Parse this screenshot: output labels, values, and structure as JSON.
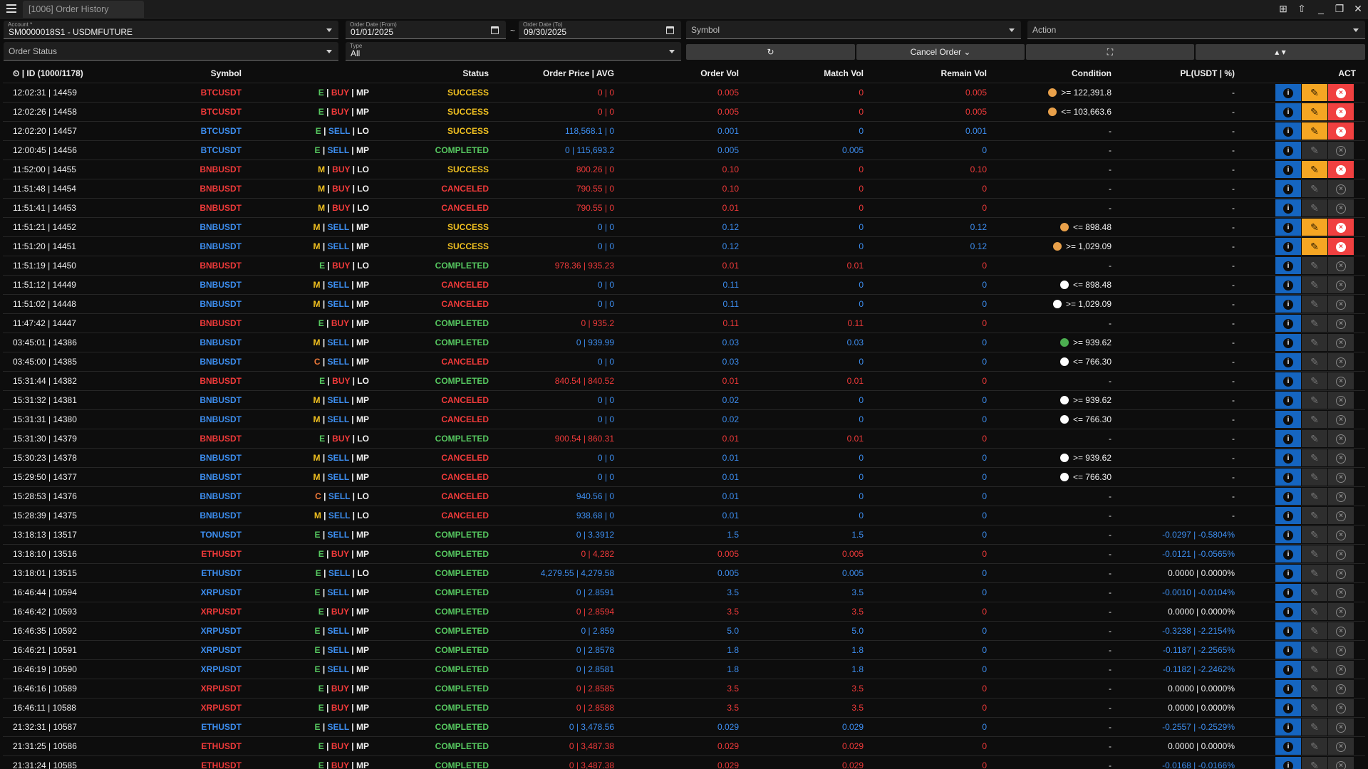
{
  "window": {
    "tab_title": "[1006] Order History"
  },
  "filters": {
    "account_label": "Account *",
    "account_value": "SM0000018S1 - USDMFUTURE",
    "date_from_label": "Order Date (From)",
    "date_from_value": "01/01/2025",
    "date_sep": "~",
    "date_to_label": "Order Date (To)",
    "date_to_value": "09/30/2025",
    "symbol_placeholder": "Symbol",
    "action_placeholder": "Action",
    "order_status_placeholder": "Order Status",
    "type_label": "Type",
    "type_value": "All",
    "refresh_label": "↻",
    "cancel_order_label": "Cancel Order ⌄",
    "fullscreen_label": "⛶",
    "sort_label": "▴ ▾"
  },
  "table": {
    "headers": {
      "id": "| ID (1000/1178)",
      "symbol": "Symbol",
      "status": "Status",
      "price": "Order Price | AVG",
      "order_vol": "Order Vol",
      "match_vol": "Match Vol",
      "remain_vol": "Remain Vol",
      "condition": "Condition",
      "pl": "PL(USDT | %)",
      "act": "ACT"
    },
    "rows": [
      {
        "id": "12:02:31 | 14459",
        "symbol": "BTCUSDT",
        "mode": "E",
        "side": "BUY",
        "otype": "MP",
        "status": "SUCCESS",
        "price": "0 | 0",
        "ovol": "0.005",
        "mvol": "0",
        "rvol": "0.005",
        "cond_dot": "#e8a04a",
        "cond": ">= 122,391.8",
        "pl": "-",
        "pl_color": "white",
        "editable": true
      },
      {
        "id": "12:02:26 | 14458",
        "symbol": "BTCUSDT",
        "mode": "E",
        "side": "BUY",
        "otype": "MP",
        "status": "SUCCESS",
        "price": "0 | 0",
        "ovol": "0.005",
        "mvol": "0",
        "rvol": "0.005",
        "cond_dot": "#e8a04a",
        "cond": "<= 103,663.6",
        "pl": "-",
        "pl_color": "white",
        "editable": true
      },
      {
        "id": "12:02:20 | 14457",
        "symbol": "BTCUSDT",
        "mode": "E",
        "side": "SELL",
        "otype": "LO",
        "status": "SUCCESS",
        "price": "118,568.1 | 0",
        "ovol": "0.001",
        "mvol": "0",
        "rvol": "0.001",
        "cond_dot": "",
        "cond": "-",
        "pl": "-",
        "pl_color": "white",
        "editable": true
      },
      {
        "id": "12:00:45 | 14456",
        "symbol": "BTCUSDT",
        "mode": "E",
        "side": "SELL",
        "otype": "MP",
        "status": "COMPLETED",
        "price": "0 | 115,693.2",
        "ovol": "0.005",
        "mvol": "0.005",
        "rvol": "0",
        "cond_dot": "",
        "cond": "-",
        "pl": "-",
        "pl_color": "white",
        "editable": false
      },
      {
        "id": "11:52:00 | 14455",
        "symbol": "BNBUSDT",
        "mode": "M",
        "side": "BUY",
        "otype": "LO",
        "status": "SUCCESS",
        "price": "800.26 | 0",
        "ovol": "0.10",
        "mvol": "0",
        "rvol": "0.10",
        "cond_dot": "",
        "cond": "-",
        "pl": "-",
        "pl_color": "white",
        "editable": true
      },
      {
        "id": "11:51:48 | 14454",
        "symbol": "BNBUSDT",
        "mode": "M",
        "side": "BUY",
        "otype": "LO",
        "status": "CANCELED",
        "price": "790.55 | 0",
        "ovol": "0.10",
        "mvol": "0",
        "rvol": "0",
        "cond_dot": "",
        "cond": "-",
        "pl": "-",
        "pl_color": "white",
        "editable": false
      },
      {
        "id": "11:51:41 | 14453",
        "symbol": "BNBUSDT",
        "mode": "M",
        "side": "BUY",
        "otype": "LO",
        "status": "CANCELED",
        "price": "790.55 | 0",
        "ovol": "0.01",
        "mvol": "0",
        "rvol": "0",
        "cond_dot": "",
        "cond": "-",
        "pl": "-",
        "pl_color": "white",
        "editable": false
      },
      {
        "id": "11:51:21 | 14452",
        "symbol": "BNBUSDT",
        "mode": "M",
        "side": "SELL",
        "otype": "MP",
        "status": "SUCCESS",
        "price": "0 | 0",
        "ovol": "0.12",
        "mvol": "0",
        "rvol": "0.12",
        "cond_dot": "#e8a04a",
        "cond": "<= 898.48",
        "pl": "-",
        "pl_color": "white",
        "editable": true
      },
      {
        "id": "11:51:20 | 14451",
        "symbol": "BNBUSDT",
        "mode": "M",
        "side": "SELL",
        "otype": "MP",
        "status": "SUCCESS",
        "price": "0 | 0",
        "ovol": "0.12",
        "mvol": "0",
        "rvol": "0.12",
        "cond_dot": "#e8a04a",
        "cond": ">= 1,029.09",
        "pl": "-",
        "pl_color": "white",
        "editable": true
      },
      {
        "id": "11:51:19 | 14450",
        "symbol": "BNBUSDT",
        "mode": "E",
        "side": "BUY",
        "otype": "LO",
        "status": "COMPLETED",
        "price": "978.36 | 935.23",
        "ovol": "0.01",
        "mvol": "0.01",
        "rvol": "0",
        "cond_dot": "",
        "cond": "-",
        "pl": "-",
        "pl_color": "white",
        "editable": false
      },
      {
        "id": "11:51:12 | 14449",
        "symbol": "BNBUSDT",
        "mode": "M",
        "side": "SELL",
        "otype": "MP",
        "status": "CANCELED",
        "price": "0 | 0",
        "ovol": "0.11",
        "mvol": "0",
        "rvol": "0",
        "cond_dot": "#ffffff",
        "cond": "<= 898.48",
        "pl": "-",
        "pl_color": "white",
        "editable": false
      },
      {
        "id": "11:51:02 | 14448",
        "symbol": "BNBUSDT",
        "mode": "M",
        "side": "SELL",
        "otype": "MP",
        "status": "CANCELED",
        "price": "0 | 0",
        "ovol": "0.11",
        "mvol": "0",
        "rvol": "0",
        "cond_dot": "#ffffff",
        "cond": ">= 1,029.09",
        "pl": "-",
        "pl_color": "white",
        "editable": false
      },
      {
        "id": "11:47:42 | 14447",
        "symbol": "BNBUSDT",
        "mode": "E",
        "side": "BUY",
        "otype": "MP",
        "status": "COMPLETED",
        "price": "0 | 935.2",
        "ovol": "0.11",
        "mvol": "0.11",
        "rvol": "0",
        "cond_dot": "",
        "cond": "-",
        "pl": "-",
        "pl_color": "white",
        "editable": false
      },
      {
        "id": "03:45:01 | 14386",
        "symbol": "BNBUSDT",
        "mode": "M",
        "side": "SELL",
        "otype": "MP",
        "status": "COMPLETED",
        "price": "0 | 939.99",
        "ovol": "0.03",
        "mvol": "0.03",
        "rvol": "0",
        "cond_dot": "#4caf50",
        "cond": ">= 939.62",
        "pl": "-",
        "pl_color": "white",
        "editable": false
      },
      {
        "id": "03:45:00 | 14385",
        "symbol": "BNBUSDT",
        "mode": "C",
        "side": "SELL",
        "otype": "MP",
        "status": "CANCELED",
        "price": "0 | 0",
        "ovol": "0.03",
        "mvol": "0",
        "rvol": "0",
        "cond_dot": "#ffffff",
        "cond": "<= 766.30",
        "pl": "-",
        "pl_color": "white",
        "editable": false
      },
      {
        "id": "15:31:44 | 14382",
        "symbol": "BNBUSDT",
        "mode": "E",
        "side": "BUY",
        "otype": "LO",
        "status": "COMPLETED",
        "price": "840.54 | 840.52",
        "ovol": "0.01",
        "mvol": "0.01",
        "rvol": "0",
        "cond_dot": "",
        "cond": "-",
        "pl": "-",
        "pl_color": "white",
        "editable": false
      },
      {
        "id": "15:31:32 | 14381",
        "symbol": "BNBUSDT",
        "mode": "M",
        "side": "SELL",
        "otype": "MP",
        "status": "CANCELED",
        "price": "0 | 0",
        "ovol": "0.02",
        "mvol": "0",
        "rvol": "0",
        "cond_dot": "#ffffff",
        "cond": ">= 939.62",
        "pl": "-",
        "pl_color": "white",
        "editable": false
      },
      {
        "id": "15:31:31 | 14380",
        "symbol": "BNBUSDT",
        "mode": "M",
        "side": "SELL",
        "otype": "MP",
        "status": "CANCELED",
        "price": "0 | 0",
        "ovol": "0.02",
        "mvol": "0",
        "rvol": "0",
        "cond_dot": "#ffffff",
        "cond": "<= 766.30",
        "pl": "-",
        "pl_color": "white",
        "editable": false
      },
      {
        "id": "15:31:30 | 14379",
        "symbol": "BNBUSDT",
        "mode": "E",
        "side": "BUY",
        "otype": "LO",
        "status": "COMPLETED",
        "price": "900.54 | 860.31",
        "ovol": "0.01",
        "mvol": "0.01",
        "rvol": "0",
        "cond_dot": "",
        "cond": "-",
        "pl": "-",
        "pl_color": "white",
        "editable": false
      },
      {
        "id": "15:30:23 | 14378",
        "symbol": "BNBUSDT",
        "mode": "M",
        "side": "SELL",
        "otype": "MP",
        "status": "CANCELED",
        "price": "0 | 0",
        "ovol": "0.01",
        "mvol": "0",
        "rvol": "0",
        "cond_dot": "#ffffff",
        "cond": ">= 939.62",
        "pl": "-",
        "pl_color": "white",
        "editable": false
      },
      {
        "id": "15:29:50 | 14377",
        "symbol": "BNBUSDT",
        "mode": "M",
        "side": "SELL",
        "otype": "MP",
        "status": "CANCELED",
        "price": "0 | 0",
        "ovol": "0.01",
        "mvol": "0",
        "rvol": "0",
        "cond_dot": "#ffffff",
        "cond": "<= 766.30",
        "pl": "-",
        "pl_color": "white",
        "editable": false
      },
      {
        "id": "15:28:53 | 14376",
        "symbol": "BNBUSDT",
        "mode": "C",
        "side": "SELL",
        "otype": "LO",
        "status": "CANCELED",
        "price": "940.56 | 0",
        "ovol": "0.01",
        "mvol": "0",
        "rvol": "0",
        "cond_dot": "",
        "cond": "-",
        "pl": "-",
        "pl_color": "white",
        "editable": false
      },
      {
        "id": "15:28:39 | 14375",
        "symbol": "BNBUSDT",
        "mode": "M",
        "side": "SELL",
        "otype": "LO",
        "status": "CANCELED",
        "price": "938.68 | 0",
        "ovol": "0.01",
        "mvol": "0",
        "rvol": "0",
        "cond_dot": "",
        "cond": "-",
        "pl": "-",
        "pl_color": "white",
        "editable": false
      },
      {
        "id": "13:18:13 | 13517",
        "symbol": "TONUSDT",
        "mode": "E",
        "side": "SELL",
        "otype": "MP",
        "status": "COMPLETED",
        "price": "0 | 3.3912",
        "ovol": "1.5",
        "mvol": "1.5",
        "rvol": "0",
        "cond_dot": "",
        "cond": "-",
        "pl": "-0.0297 | -0.5804%",
        "pl_color": "blue",
        "editable": false
      },
      {
        "id": "13:18:10 | 13516",
        "symbol": "ETHUSDT",
        "mode": "E",
        "side": "BUY",
        "otype": "MP",
        "status": "COMPLETED",
        "price": "0 | 4,282",
        "ovol": "0.005",
        "mvol": "0.005",
        "rvol": "0",
        "cond_dot": "",
        "cond": "-",
        "pl": "-0.0121 | -0.0565%",
        "pl_color": "blue",
        "editable": false
      },
      {
        "id": "13:18:01 | 13515",
        "symbol": "ETHUSDT",
        "mode": "E",
        "side": "SELL",
        "otype": "LO",
        "status": "COMPLETED",
        "price": "4,279.55 | 4,279.58",
        "ovol": "0.005",
        "mvol": "0.005",
        "rvol": "0",
        "cond_dot": "",
        "cond": "-",
        "pl": "0.0000 | 0.0000%",
        "pl_color": "white",
        "editable": false
      },
      {
        "id": "16:46:44 | 10594",
        "symbol": "XRPUSDT",
        "mode": "E",
        "side": "SELL",
        "otype": "MP",
        "status": "COMPLETED",
        "price": "0 | 2.8591",
        "ovol": "3.5",
        "mvol": "3.5",
        "rvol": "0",
        "cond_dot": "",
        "cond": "-",
        "pl": "-0.0010 | -0.0104%",
        "pl_color": "blue",
        "editable": false
      },
      {
        "id": "16:46:42 | 10593",
        "symbol": "XRPUSDT",
        "mode": "E",
        "side": "BUY",
        "otype": "MP",
        "status": "COMPLETED",
        "price": "0 | 2.8594",
        "ovol": "3.5",
        "mvol": "3.5",
        "rvol": "0",
        "cond_dot": "",
        "cond": "-",
        "pl": "0.0000 | 0.0000%",
        "pl_color": "white",
        "editable": false
      },
      {
        "id": "16:46:35 | 10592",
        "symbol": "XRPUSDT",
        "mode": "E",
        "side": "SELL",
        "otype": "MP",
        "status": "COMPLETED",
        "price": "0 | 2.859",
        "ovol": "5.0",
        "mvol": "5.0",
        "rvol": "0",
        "cond_dot": "",
        "cond": "-",
        "pl": "-0.3238 | -2.2154%",
        "pl_color": "blue",
        "editable": false
      },
      {
        "id": "16:46:21 | 10591",
        "symbol": "XRPUSDT",
        "mode": "E",
        "side": "SELL",
        "otype": "MP",
        "status": "COMPLETED",
        "price": "0 | 2.8578",
        "ovol": "1.8",
        "mvol": "1.8",
        "rvol": "0",
        "cond_dot": "",
        "cond": "-",
        "pl": "-0.1187 | -2.2565%",
        "pl_color": "blue",
        "editable": false
      },
      {
        "id": "16:46:19 | 10590",
        "symbol": "XRPUSDT",
        "mode": "E",
        "side": "SELL",
        "otype": "MP",
        "status": "COMPLETED",
        "price": "0 | 2.8581",
        "ovol": "1.8",
        "mvol": "1.8",
        "rvol": "0",
        "cond_dot": "",
        "cond": "-",
        "pl": "-0.1182 | -2.2462%",
        "pl_color": "blue",
        "editable": false
      },
      {
        "id": "16:46:16 | 10589",
        "symbol": "XRPUSDT",
        "mode": "E",
        "side": "BUY",
        "otype": "MP",
        "status": "COMPLETED",
        "price": "0 | 2.8585",
        "ovol": "3.5",
        "mvol": "3.5",
        "rvol": "0",
        "cond_dot": "",
        "cond": "-",
        "pl": "0.0000 | 0.0000%",
        "pl_color": "white",
        "editable": false
      },
      {
        "id": "16:46:11 | 10588",
        "symbol": "XRPUSDT",
        "mode": "E",
        "side": "BUY",
        "otype": "MP",
        "status": "COMPLETED",
        "price": "0 | 2.8588",
        "ovol": "3.5",
        "mvol": "3.5",
        "rvol": "0",
        "cond_dot": "",
        "cond": "-",
        "pl": "0.0000 | 0.0000%",
        "pl_color": "white",
        "editable": false
      },
      {
        "id": "21:32:31 | 10587",
        "symbol": "ETHUSDT",
        "mode": "E",
        "side": "SELL",
        "otype": "MP",
        "status": "COMPLETED",
        "price": "0 | 3,478.56",
        "ovol": "0.029",
        "mvol": "0.029",
        "rvol": "0",
        "cond_dot": "",
        "cond": "-",
        "pl": "-0.2557 | -0.2529%",
        "pl_color": "blue",
        "editable": false
      },
      {
        "id": "21:31:25 | 10586",
        "symbol": "ETHUSDT",
        "mode": "E",
        "side": "BUY",
        "otype": "MP",
        "status": "COMPLETED",
        "price": "0 | 3,487.38",
        "ovol": "0.029",
        "mvol": "0.029",
        "rvol": "0",
        "cond_dot": "",
        "cond": "-",
        "pl": "0.0000 | 0.0000%",
        "pl_color": "white",
        "editable": false
      },
      {
        "id": "21:31:24 | 10585",
        "symbol": "ETHUSDT",
        "mode": "E",
        "side": "BUY",
        "otype": "MP",
        "status": "COMPLETED",
        "price": "0 | 3,487.38",
        "ovol": "0.029",
        "mvol": "0.029",
        "rvol": "0",
        "cond_dot": "",
        "cond": "-",
        "pl": "-0.0168 | -0.0166%",
        "pl_color": "blue",
        "editable": false
      }
    ]
  },
  "colors": {
    "buy": "#f03a3a",
    "sell": "#3d8ef0",
    "completed": "#56c860",
    "success": "#f0c020",
    "canceled": "#f03a3a",
    "mode_e": "#56c860",
    "mode_m": "#f0c020",
    "mode_c": "#f07a3a"
  }
}
